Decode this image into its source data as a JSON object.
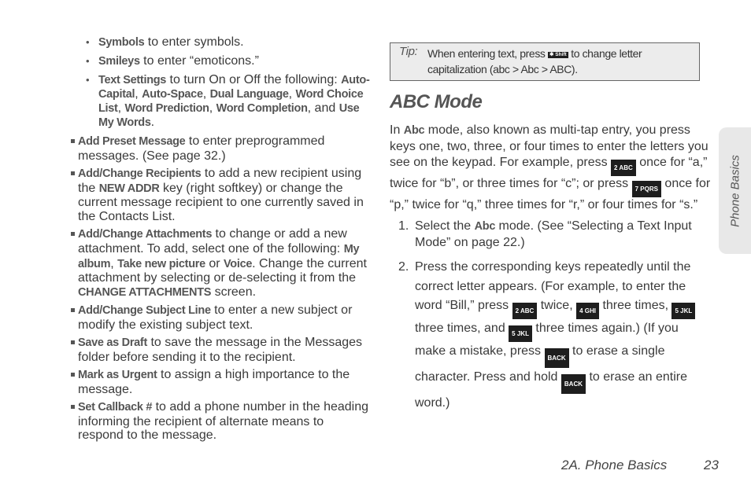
{
  "left_column": {
    "sub_items": [
      {
        "term": "Symbols",
        "text": " to enter symbols."
      },
      {
        "term": "Smileys",
        "text": " to enter “emoticons.”"
      },
      {
        "term": "Text Settings",
        "text": " to turn On or Off the following: ",
        "options": [
          "Auto-Capital",
          "Auto-Space",
          "Dual Language",
          "Word Choice List",
          "Word Prediction",
          "Word Completion"
        ],
        "and_label": "and ",
        "last_option": "Use My Words"
      }
    ],
    "items": [
      {
        "term": "Add Preset Message",
        "text": " to enter preprogrammed messages. (See page 32.)"
      },
      {
        "term": "Add/Change Recipients",
        "text_a": " to add a new recipient using the ",
        "key": "NEW ADDR",
        "text_b": " key (right softkey) or change the current message recipient to one currently saved in the Contacts List."
      },
      {
        "term": "Add/Change Attachments",
        "text_a": " to change or add a new attachment. To add, select one of the following: ",
        "opt1": "My album",
        "opt2": "Take new picture",
        "or_label": " or ",
        "opt3": "Voice",
        "text_b": ". Change the current attachment by selecting or de-selecting it from the ",
        "screen": "CHANGE ATTACHMENTS",
        "text_c": " screen."
      },
      {
        "term": "Add/Change Subject Line",
        "text": " to enter a new subject or modify the existing subject text."
      },
      {
        "term": "Save as Draft",
        "text": " to save the message in the Messages folder before sending it to the recipient."
      },
      {
        "term": "Mark as Urgent",
        "text": " to assign a high importance to the message."
      },
      {
        "term": "Set Callback #",
        "text": " to add a phone number in the heading informing the recipient of alternate means to respond to the message."
      }
    ]
  },
  "tip": {
    "label": "Tip:",
    "text_a": "When entering text, press ",
    "key": "✱ Shift",
    "text_b": " to change letter capitalization (abc > Abc > ABC)."
  },
  "section": {
    "heading": "ABC Mode",
    "intro_a": "In ",
    "intro_mode": "Abc",
    "intro_b": " mode, also known as multi-tap entry, you press keys one, two, three, or four times to enter the letters you see on the keypad. For example, press ",
    "key_2": "2 ABC",
    "intro_c": " once for “a,” twice for “b”, or three times for “c”; or press ",
    "key_7": "7 PQRS",
    "intro_d": " once for “p,” twice for “q,” three times for “r,” or four times for “s.”",
    "steps": [
      {
        "num": "1.",
        "text_a": "Select the ",
        "mode": "Abc",
        "text_b": " mode. (See “Selecting a Text Input Mode” on page 22.)"
      },
      {
        "num": "2.",
        "text_a": "Press the corresponding keys repeatedly until the correct letter appears. (For example, to enter the word “Bill,” press ",
        "key_2": "2 ABC",
        "text_b": " twice, ",
        "key_4": "4 GHI",
        "text_c": " three times, ",
        "key_5a": "5 JKL",
        "text_d": " three times, and ",
        "key_5b": "5 JKL",
        "text_e": " three times again.) (If you make a mistake, press ",
        "key_back_a": "BACK",
        "text_f": " to erase a single character. Press and hold ",
        "key_back_b": "BACK",
        "text_g": " to erase an entire word.)"
      }
    ]
  },
  "side_tab": {
    "label": "Phone Basics"
  },
  "footer": {
    "section": "2A. Phone Basics",
    "page": "23"
  }
}
